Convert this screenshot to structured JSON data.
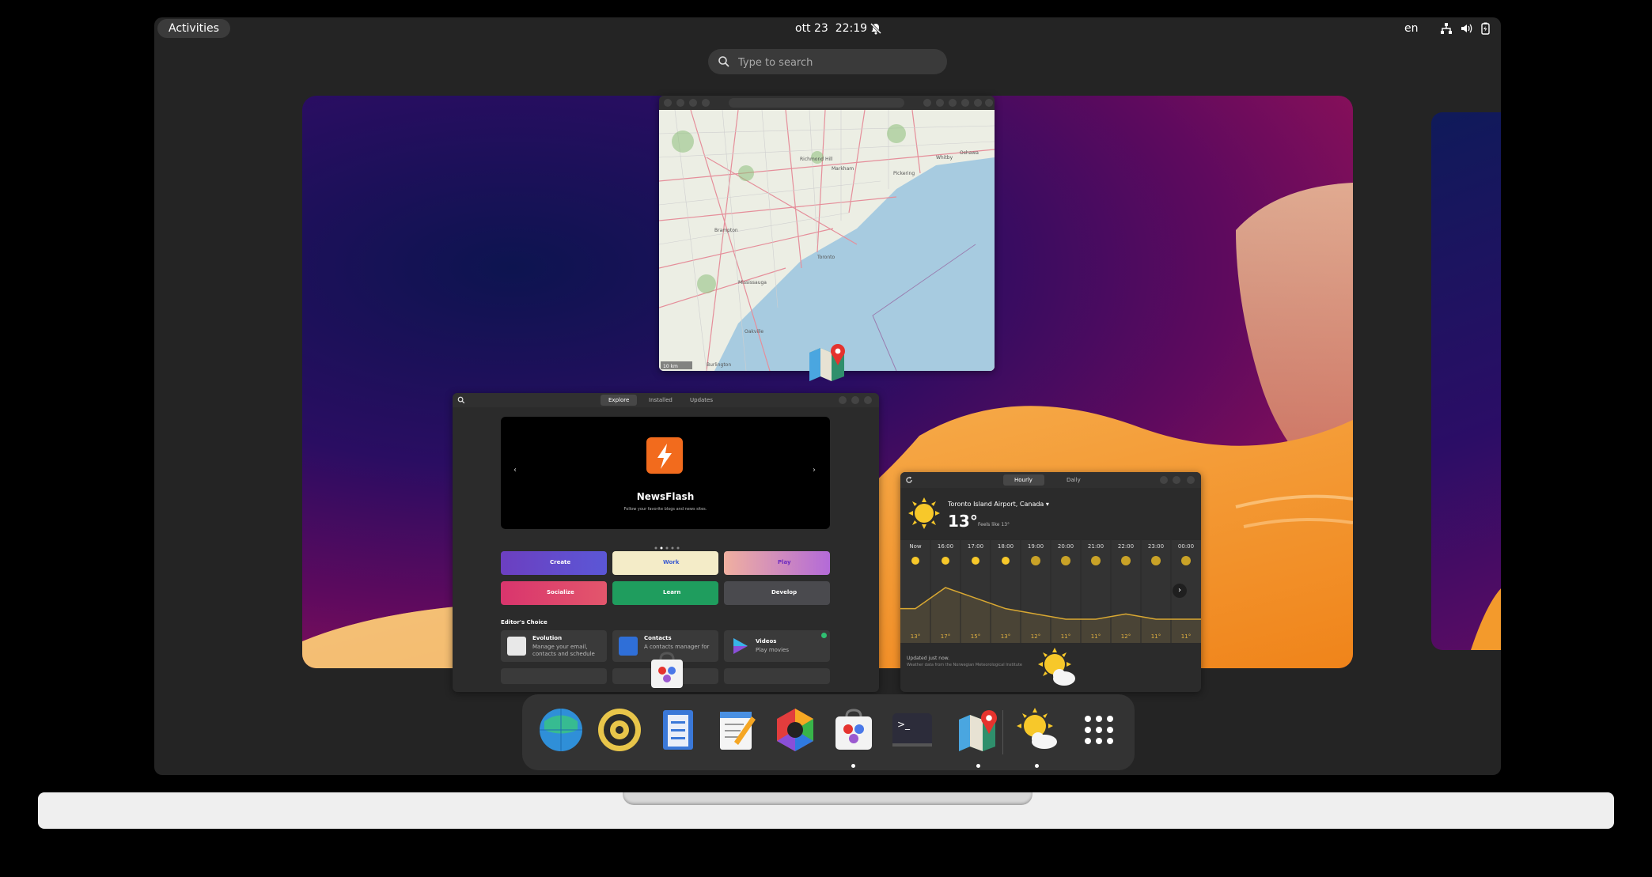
{
  "topbar": {
    "activities": "Activities",
    "date": "ott 23",
    "time": "22:19",
    "lang": "en"
  },
  "search": {
    "placeholder": "Type to search"
  },
  "software": {
    "tabs": [
      "Explore",
      "Installed",
      "Updates"
    ],
    "hero_title": "NewsFlash",
    "hero_sub": "Follow your favorite blogs and news sites.",
    "categories": [
      "Create",
      "Work",
      "Play",
      "Socialize",
      "Learn",
      "Develop"
    ],
    "section": "Editor's Choice",
    "picks": [
      {
        "name": "Evolution",
        "desc1": "Manage your email,",
        "desc2": "contacts and schedule"
      },
      {
        "name": "Contacts",
        "desc1": "A contacts manager for",
        "desc2": ""
      },
      {
        "name": "Videos",
        "desc1": "Play movies",
        "desc2": ""
      }
    ]
  },
  "weather": {
    "tabs": [
      "Hourly",
      "Daily"
    ],
    "location": "Toronto Island Airport, Canada",
    "temp": "13°",
    "feels": "Feels like 13°",
    "hours": [
      "Now",
      "16:00",
      "17:00",
      "18:00",
      "19:00",
      "20:00",
      "21:00",
      "22:00",
      "23:00",
      "00:00"
    ],
    "temps": [
      13,
      17,
      15,
      13,
      12,
      11,
      11,
      12,
      11,
      11
    ],
    "temp_labels": [
      "13°",
      "17°",
      "15°",
      "13°",
      "12°",
      "11°",
      "11°",
      "12°",
      "11°",
      "11°"
    ],
    "updated": "Updated just now.",
    "source": "Weather data from the Norwegian Meteorological Institute"
  },
  "maps": {
    "cities": [
      "Richmond Hill",
      "Markham",
      "Pickering",
      "Oshawa",
      "Whitby",
      "Brampton",
      "Toronto",
      "Mississauga",
      "Oakville",
      "Burlington"
    ],
    "scale": "10 km"
  },
  "dock": {
    "apps": [
      "web-browser",
      "rhythmbox",
      "files",
      "text-editor",
      "image-viewer",
      "software",
      "terminal",
      "maps",
      "weather",
      "show-apps"
    ]
  }
}
